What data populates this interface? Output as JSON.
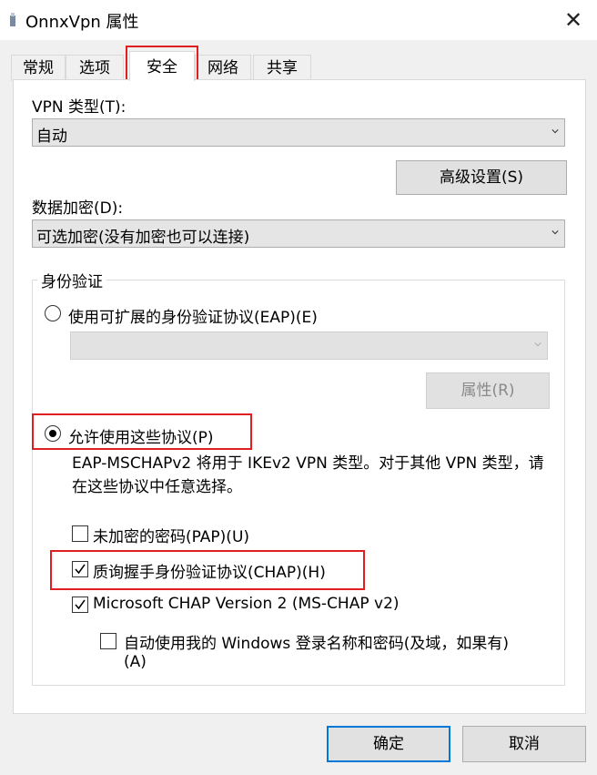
{
  "window": {
    "title": "OnnxVpn 属性"
  },
  "tabs": [
    {
      "label": "常规",
      "active": false
    },
    {
      "label": "选项",
      "active": false
    },
    {
      "label": "安全",
      "active": true
    },
    {
      "label": "网络",
      "active": false
    },
    {
      "label": "共享",
      "active": false
    }
  ],
  "security": {
    "vpn_type_label": "VPN 类型(T):",
    "vpn_type_value": "自动",
    "advanced_button": "高级设置(S)",
    "encryption_label": "数据加密(D):",
    "encryption_value": "可选加密(没有加密也可以连接)",
    "auth": {
      "group_title": "身份验证",
      "eap_radio_label": "使用可扩展的身份验证协议(EAP)(E)",
      "eap_radio_selected": false,
      "eap_select_value": "",
      "properties_button": "属性(R)",
      "allow_radio_label": "允许使用这些协议(P)",
      "allow_radio_selected": true,
      "description": "EAP-MSCHAPv2 将用于 IKEv2 VPN 类型。对于其他 VPN 类型，请在这些协议中任意选择。",
      "protocols": {
        "pap": {
          "label": "未加密的密码(PAP)(U)",
          "checked": false
        },
        "chap": {
          "label": "质询握手身份验证协议(CHAP)(H)",
          "checked": true
        },
        "mschap": {
          "label": "Microsoft CHAP Version 2 (MS-CHAP v2)",
          "checked": true
        },
        "auto_windows": {
          "label_line1": "自动使用我的 Windows 登录名称和密码(及域，如果有)",
          "label_line2": "(A)",
          "checked": false
        }
      }
    }
  },
  "footer": {
    "ok_button": "确定",
    "cancel_button": "取消"
  },
  "colors": {
    "highlight": "#e02020",
    "focus": "#0078d7"
  }
}
